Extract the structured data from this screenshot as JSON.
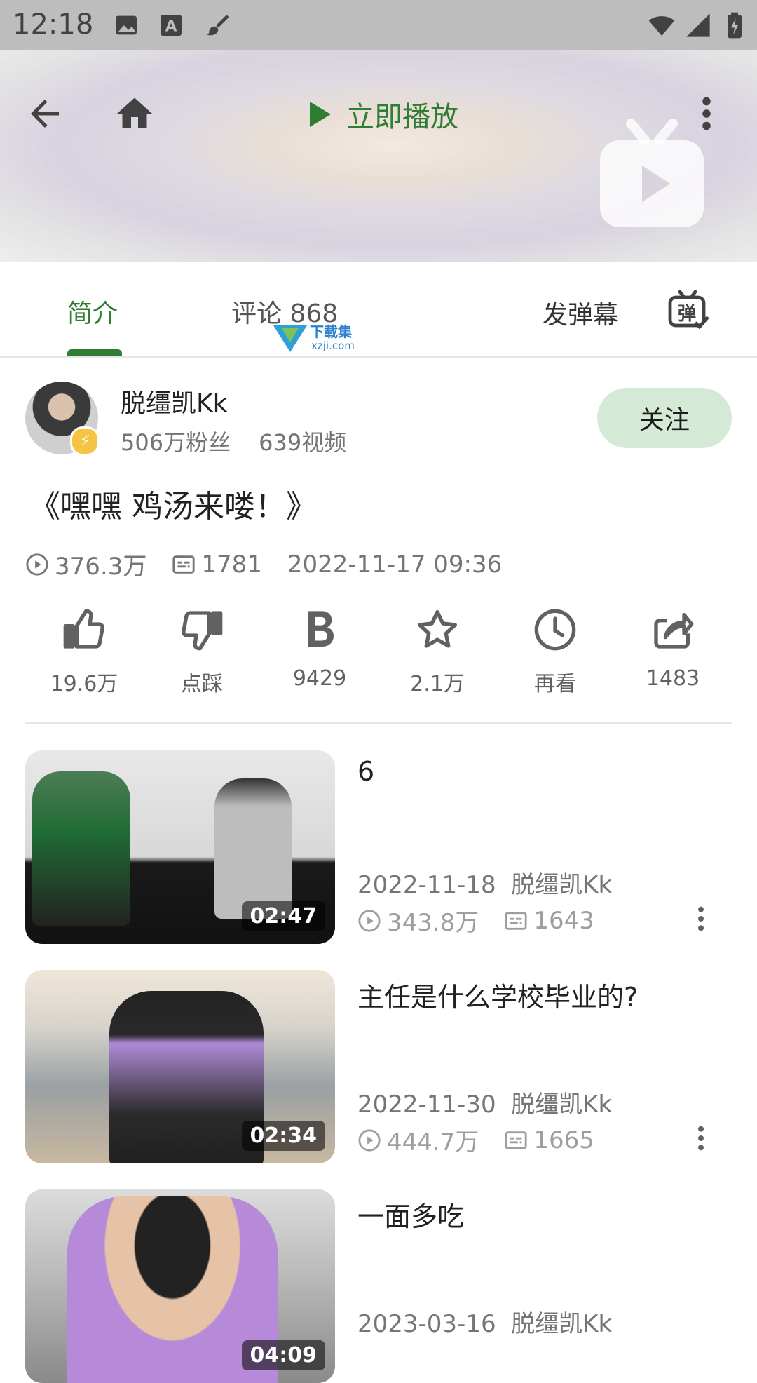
{
  "status_bar": {
    "time": "12:18"
  },
  "header": {
    "play_now_label": "立即播放"
  },
  "tabs": {
    "intro": "简介",
    "comments": "评论 868",
    "send_danmaku": "发弹幕",
    "danmaku_icon_text": "弹"
  },
  "watermark": {
    "brand": "下载集",
    "url": "xzji.com"
  },
  "uploader": {
    "name": "脱缰凯Kk",
    "fans": "506万粉丝",
    "videos": "639视频",
    "follow_label": "关注"
  },
  "video": {
    "title": "《嘿嘿 鸡汤来喽！》",
    "views": "376.3万",
    "danmaku_count": "1781",
    "date": "2022-11-17 09:36"
  },
  "actions": [
    {
      "icon": "thumb-up-icon",
      "label": "19.6万"
    },
    {
      "icon": "thumb-down-icon",
      "label": "点踩"
    },
    {
      "icon": "coin-icon",
      "label": "9429"
    },
    {
      "icon": "star-icon",
      "label": "2.1万"
    },
    {
      "icon": "clock-icon",
      "label": "再看"
    },
    {
      "icon": "share-icon",
      "label": "1483"
    }
  ],
  "related": [
    {
      "title": "6",
      "date": "2022-11-18",
      "author": "脱缰凯Kk",
      "views": "343.8万",
      "danmaku": "1643",
      "duration": "02:47"
    },
    {
      "title": "主任是什么学校毕业的?",
      "date": "2022-11-30",
      "author": "脱缰凯Kk",
      "views": "444.7万",
      "danmaku": "1665",
      "duration": "02:34"
    },
    {
      "title": "一面多吃",
      "date": "2023-03-16",
      "author": "脱缰凯Kk",
      "views": "",
      "danmaku": "",
      "duration": "04:09"
    }
  ],
  "colors": {
    "accent": "#2e7d32",
    "follow_bg": "#d4ead6",
    "status_bar": "#bdbdbd"
  }
}
